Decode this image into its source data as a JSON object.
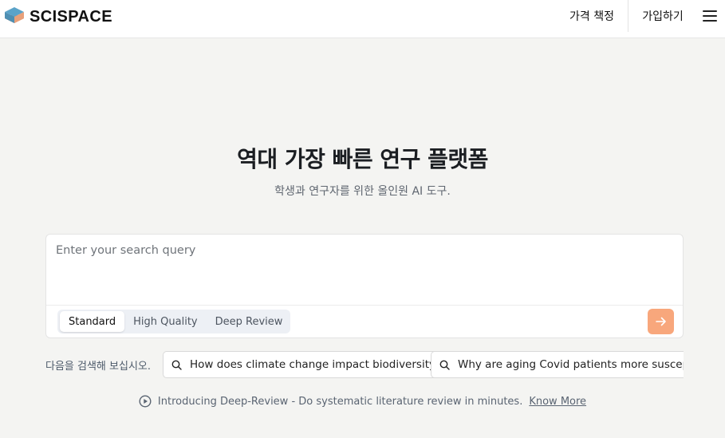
{
  "header": {
    "logo_text": "SCISPACE",
    "pricing_label": "가격 책정",
    "signup_label": "가입하기",
    "menu_icon": "hamburger-menu-icon"
  },
  "hero": {
    "title": "역대 가장 빠른 연구 플랫폼",
    "subtitle": "학생과 연구자를 위한 올인원 AI 도구."
  },
  "search": {
    "placeholder": "Enter your search query",
    "value": "",
    "modes": [
      {
        "label": "Standard",
        "selected": true
      },
      {
        "label": "High Quality",
        "selected": false
      },
      {
        "label": "Deep Review",
        "selected": false
      }
    ],
    "submit_icon": "arrow-right-icon",
    "submit_color": "#f8a77c"
  },
  "suggestions": {
    "label": "다음을 검색해 보십시오.",
    "items": [
      "How does climate change impact biodiversity?",
      "Why are aging Covid patients more susceptible to severe complications?"
    ]
  },
  "promo": {
    "icon": "play-circle-icon",
    "text": "Introducing Deep-Review - Do systematic literature review in minutes.",
    "link_text": "Know More"
  },
  "colors": {
    "background": "#f4f4f2",
    "logo_orange": "#f07a3b",
    "logo_blue": "#5ba3c9"
  }
}
